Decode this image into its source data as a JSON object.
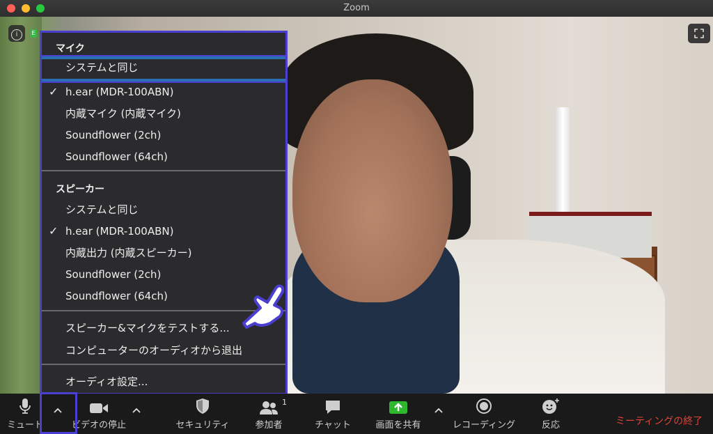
{
  "window": {
    "title": "Zoom"
  },
  "video": {
    "encryption_badge": "E"
  },
  "menu": {
    "mic_header": "マイク",
    "mic_items": [
      {
        "label": "システムと同じ",
        "checked": false,
        "selected": true
      },
      {
        "label": "h.ear (MDR-100ABN)",
        "checked": true,
        "selected": false
      },
      {
        "label": "内蔵マイク (内蔵マイク)",
        "checked": false,
        "selected": false
      },
      {
        "label": "Soundflower (2ch)",
        "checked": false,
        "selected": false
      },
      {
        "label": "Soundflower (64ch)",
        "checked": false,
        "selected": false
      }
    ],
    "speaker_header": "スピーカー",
    "speaker_items": [
      {
        "label": "システムと同じ",
        "checked": false
      },
      {
        "label": "h.ear (MDR-100ABN)",
        "checked": true
      },
      {
        "label": "内蔵出力 (内蔵スピーカー)",
        "checked": false
      },
      {
        "label": "Soundflower (2ch)",
        "checked": false
      },
      {
        "label": "Soundflower (64ch)",
        "checked": false
      }
    ],
    "test_label": "スピーカー&マイクをテストする...",
    "leave_label": "コンピューターのオーディオから退出",
    "settings_label": "オーディオ設定...",
    "check_glyph": "✓"
  },
  "toolbar": {
    "mute_label": "ミュート",
    "video_label": "ビデオの停止",
    "security_label": "セキュリティ",
    "participants_label": "参加者",
    "participants_count": "1",
    "chat_label": "チャット",
    "share_label": "画面を共有",
    "record_label": "レコーディング",
    "reactions_label": "反応",
    "end_label": "ミーティングの終了",
    "caret_glyph": "^"
  },
  "colors": {
    "menu_border": "#4a3fd1",
    "selection_bar": "#2a6fb0",
    "end_red": "#e0443a",
    "share_green": "#2eb82e"
  }
}
